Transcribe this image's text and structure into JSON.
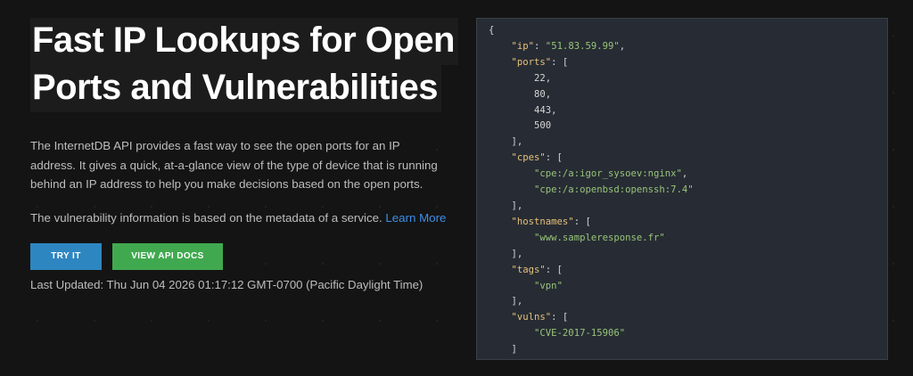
{
  "hero": {
    "title_line1": "Fast IP Lookups for Open",
    "title_line2": "Ports and Vulnerabilities",
    "description": "The InternetDB API provides a fast way to see the open ports for an IP address. It gives a quick, at-a-glance view of the type of device that is running behind an IP address to help you make decisions based on the open ports.",
    "vuln_text": "The vulnerability information is based on the metadata of a service.",
    "learn_more": "Learn More",
    "try_button": "TRY IT",
    "docs_button": "VIEW API DOCS",
    "last_updated": "Last Updated: Thu Jun 04 2026 01:17:12 GMT-0700 (Pacific Daylight Time)"
  },
  "response": {
    "ip": "51.83.59.99",
    "ports": [
      "22",
      "80",
      "443",
      "500"
    ],
    "cpes": [
      "cpe:/a:igor_sysoev:nginx",
      "cpe:/a:openbsd:openssh:7.4"
    ],
    "hostnames": [
      "www.sampleresponse.fr"
    ],
    "tags": [
      "vpn"
    ],
    "vulns": [
      "CVE-2017-15906"
    ]
  },
  "colors": {
    "background": "#141414",
    "code_background": "#272c34",
    "accent_blue": "#2e86c1",
    "accent_green": "#40a94f",
    "link": "#3d8ee8"
  }
}
